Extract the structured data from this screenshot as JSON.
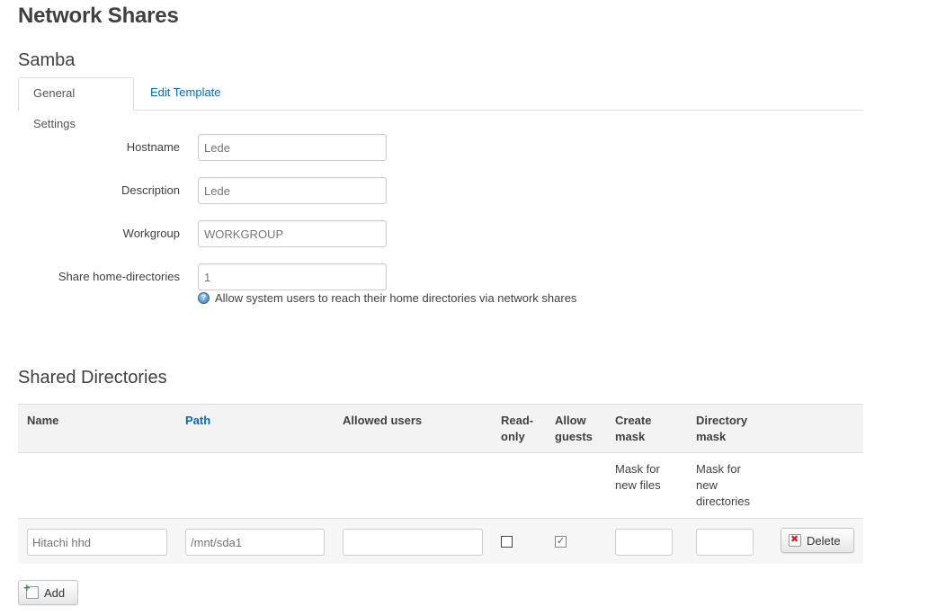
{
  "page": {
    "title": "Network Shares"
  },
  "samba": {
    "title": "Samba",
    "tabs": [
      {
        "label": "General Settings",
        "active": true
      },
      {
        "label": "Edit Template",
        "active": false
      }
    ],
    "fields": {
      "hostname": {
        "label": "Hostname",
        "placeholder": "Lede"
      },
      "description": {
        "label": "Description",
        "placeholder": "Lede"
      },
      "workgroup": {
        "label": "Workgroup",
        "placeholder": "WORKGROUP"
      },
      "homes": {
        "label": "Share home-directories",
        "placeholder": "1",
        "help": "Allow system users to reach their home directories via network shares"
      }
    }
  },
  "shares": {
    "title": "Shared Directories",
    "columns": {
      "name": "Name",
      "path": "Path",
      "users": "Allowed users",
      "read_only_1": "Read-",
      "read_only_2": "only",
      "guests_1": "Allow",
      "guests_2": "guests",
      "create_mask_1": "Create",
      "create_mask_2": "mask",
      "dir_mask_1": "Directory",
      "dir_mask_2": "mask"
    },
    "descriptions": {
      "create_mask_1": "Mask for",
      "create_mask_2": "new files",
      "dir_mask_1": "Mask for",
      "dir_mask_2": "new",
      "dir_mask_3": "directories"
    },
    "rows": [
      {
        "name_placeholder": "Hitachi hhd",
        "path_placeholder": "/mnt/sda1",
        "users": "",
        "read_only": false,
        "allow_guests": true,
        "create_mask": "",
        "dir_mask": "",
        "delete_label": "Delete"
      }
    ],
    "add_label": "Add"
  },
  "colors": {
    "link": "#0069d6",
    "text": "#404040",
    "border": "#dddddd",
    "header_bg": "#f3f3f3"
  }
}
